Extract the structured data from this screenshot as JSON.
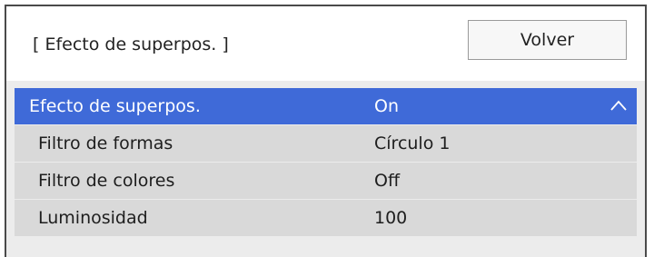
{
  "header": {
    "title": "[ Efecto de superpos. ]",
    "back_label": "Volver"
  },
  "menu": {
    "items": [
      {
        "label": "Efecto de superpos.",
        "value": "On",
        "selected": true,
        "icon": "chevron-up-icon"
      },
      {
        "label": "Filtro de formas",
        "value": "Círculo 1",
        "selected": false
      },
      {
        "label": "Filtro de colores",
        "value": "Off",
        "selected": false
      },
      {
        "label": "Luminosidad",
        "value": "100",
        "selected": false
      }
    ]
  },
  "colors": {
    "accent": "#3f6ad8",
    "row_background": "#d9d9d9",
    "panel_background": "#ececec"
  }
}
